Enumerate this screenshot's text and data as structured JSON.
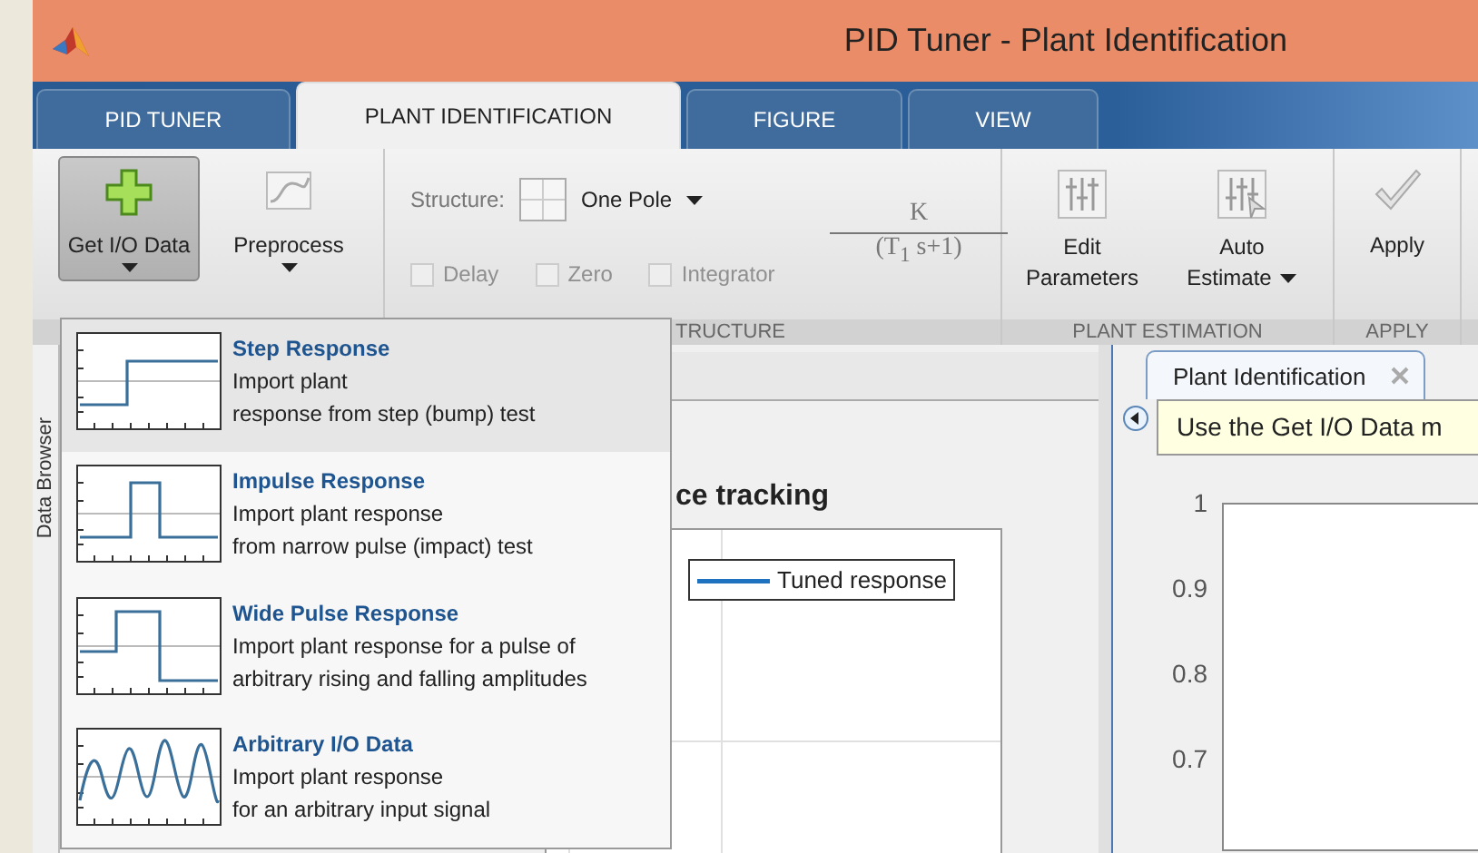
{
  "window": {
    "title": "PID Tuner - Plant Identification"
  },
  "tabs": [
    {
      "label": "PID TUNER",
      "selected": false
    },
    {
      "label": "PLANT IDENTIFICATION",
      "selected": true
    },
    {
      "label": "FIGURE",
      "selected": false
    },
    {
      "label": "VIEW",
      "selected": false
    }
  ],
  "ribbon": {
    "get_data": {
      "label": "Get I/O Data",
      "pressed": true
    },
    "preprocess": {
      "label": "Preprocess"
    },
    "structure": {
      "label": "Structure:",
      "value": "One Pole",
      "numerator": "K",
      "denominator": "(T$_{1}$ s+1)"
    },
    "options": [
      {
        "label": "Delay",
        "checked": false,
        "disabled": true
      },
      {
        "label": "Zero",
        "checked": false,
        "disabled": true
      },
      {
        "label": "Integrator",
        "checked": false,
        "disabled": true
      }
    ],
    "edit_parameters": {
      "lines": [
        "Edit",
        "Parameters"
      ]
    },
    "auto_estimate": {
      "lines": [
        "Auto",
        "Estimate"
      ]
    },
    "apply": {
      "label": "Apply"
    },
    "sections": [
      "TRUCTURE",
      "PLANT ESTIMATION",
      "APPLY"
    ]
  },
  "side_tab": "Data Browser",
  "figure": {
    "title": "ce tracking",
    "legend": "Tuned response"
  },
  "panel": {
    "tab": "Plant Identification",
    "banner": "Use the Get I/O Data m",
    "yticks": [
      "1",
      "0.9",
      "0.8",
      "0.7"
    ]
  },
  "menu": [
    {
      "kind": "step",
      "selected": true,
      "title": "Step Response",
      "lines": [
        "Import plant",
        "response from step (bump) test"
      ]
    },
    {
      "kind": "impulse",
      "selected": false,
      "title": "Impulse Response",
      "lines": [
        "Import plant response",
        "from narrow pulse (impact) test"
      ]
    },
    {
      "kind": "wide_pulse",
      "selected": false,
      "title": "Wide Pulse Response",
      "lines": [
        "Import plant response for a pulse of",
        "arbitrary rising and falling amplitudes"
      ]
    },
    {
      "kind": "arbitrary",
      "selected": false,
      "title": "Arbitrary I/O Data",
      "lines": [
        "Import plant response",
        "for an arbitrary input signal"
      ]
    }
  ]
}
